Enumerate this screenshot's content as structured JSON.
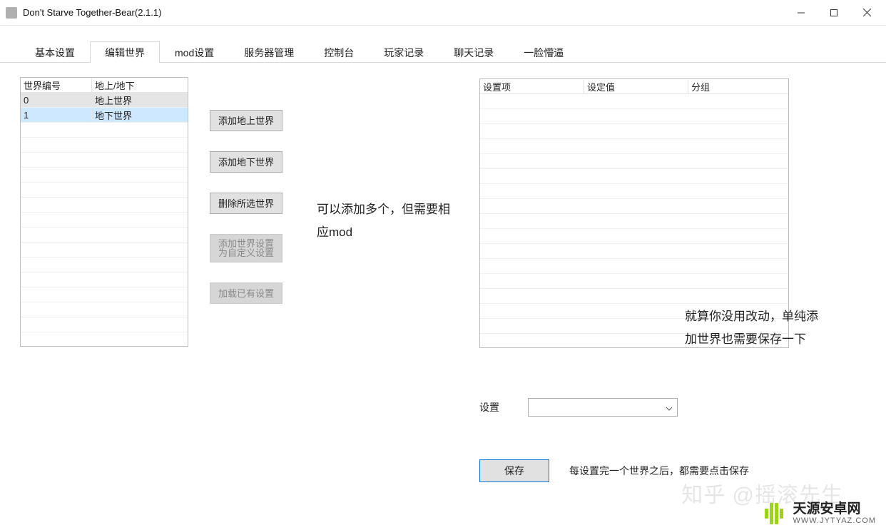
{
  "window": {
    "title": "Don't Starve Together-Bear(2.1.1)"
  },
  "tabs": [
    {
      "label": "基本设置"
    },
    {
      "label": "编辑世界"
    },
    {
      "label": "mod设置"
    },
    {
      "label": "服务器管理"
    },
    {
      "label": "控制台"
    },
    {
      "label": "玩家记录"
    },
    {
      "label": "聊天记录"
    },
    {
      "label": "一脸懵逼"
    }
  ],
  "world_table": {
    "header": {
      "id": "世界编号",
      "loc": "地上/地下"
    },
    "rows": [
      {
        "id": "0",
        "loc": "地上世界"
      },
      {
        "id": "1",
        "loc": "地下世界"
      }
    ]
  },
  "buttons": {
    "add_over": "添加地上世界",
    "add_under": "添加地下世界",
    "del_sel": "删除所选世界",
    "add_cfg_l1": "添加世界设置",
    "add_cfg_l2": "为自定义设置",
    "load_cfg": "加载已有设置"
  },
  "notes": {
    "middle": "可以添加多个，但需要相应mod",
    "right": "就算你没用改动，单纯添加世界也需要保存一下"
  },
  "settings_table": {
    "header": {
      "item": "设置项",
      "value": "设定值",
      "group": "分组"
    }
  },
  "setting_row": {
    "label": "设置",
    "combo_value": ""
  },
  "save_row": {
    "btn": "保存",
    "note": "每设置完一个世界之后，都需要点击保存"
  },
  "watermarks": {
    "zhihu": "知乎 @摇滚先生",
    "site_cn": "天源安卓网",
    "site_en": "WWW.JYTYAZ.COM"
  }
}
